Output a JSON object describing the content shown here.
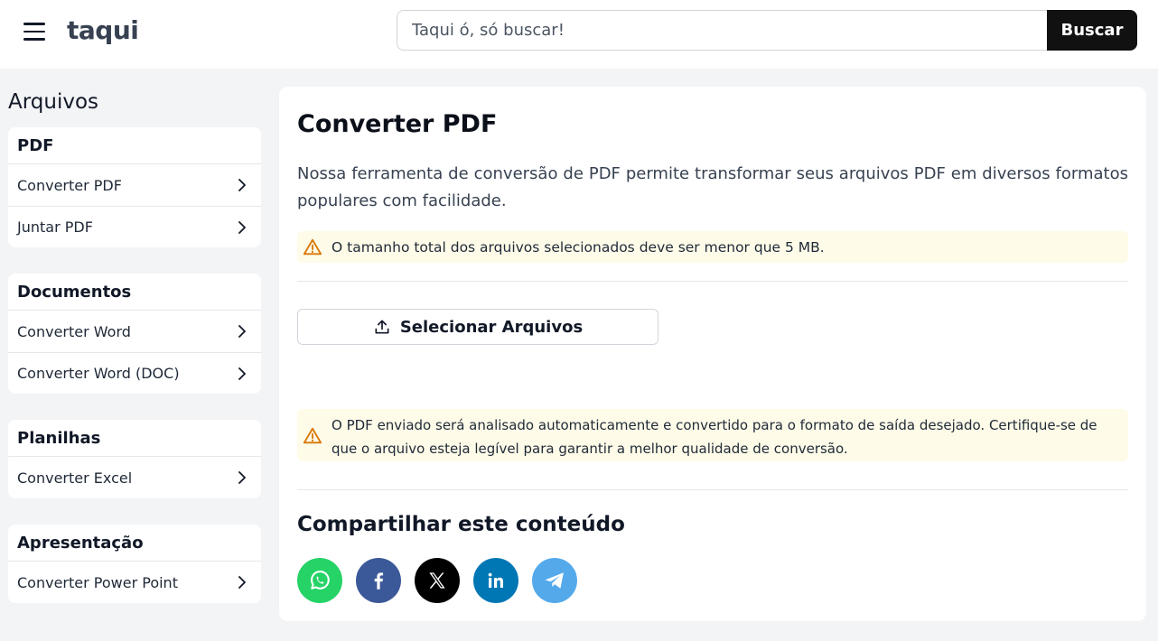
{
  "header": {
    "logo": "taqui",
    "search_placeholder": "Taqui ó, só buscar!",
    "search_button": "Buscar"
  },
  "sidebar": {
    "title": "Arquivos",
    "groups": [
      {
        "title": "PDF",
        "items": [
          "Converter PDF",
          "Juntar PDF"
        ]
      },
      {
        "title": "Documentos",
        "items": [
          "Converter Word",
          "Converter Word (DOC)"
        ]
      },
      {
        "title": "Planilhas",
        "items": [
          "Converter Excel"
        ]
      },
      {
        "title": "Apresentação",
        "items": [
          "Converter Power Point"
        ]
      }
    ]
  },
  "main": {
    "title": "Converter PDF",
    "description": "Nossa ferramenta de conversão de PDF permite transformar seus arquivos PDF em diversos formatos populares com facilidade.",
    "size_warning": "O tamanho total dos arquivos selecionados deve ser menor que 5 MB.",
    "select_button": "Selecionar Arquivos",
    "process_warning": "O PDF enviado será analisado automaticamente e convertido para o formato de saída desejado. Certifique-se de que o arquivo esteja legível para garantir a melhor qualidade de conversão.",
    "share_title": "Compartilhar este conteúdo"
  },
  "social": [
    {
      "icon": "whatsapp-icon",
      "color": "#25d366"
    },
    {
      "icon": "facebook-icon",
      "color": "#3b5998"
    },
    {
      "icon": "x-icon",
      "color": "#000000"
    },
    {
      "icon": "linkedin-icon",
      "color": "#0077b5"
    },
    {
      "icon": "telegram-icon",
      "color": "#54a9eb"
    }
  ],
  "colors": {
    "warning_bg": "#fefbe8",
    "warning_icon": "#d97706",
    "search_button_bg": "#111111"
  }
}
